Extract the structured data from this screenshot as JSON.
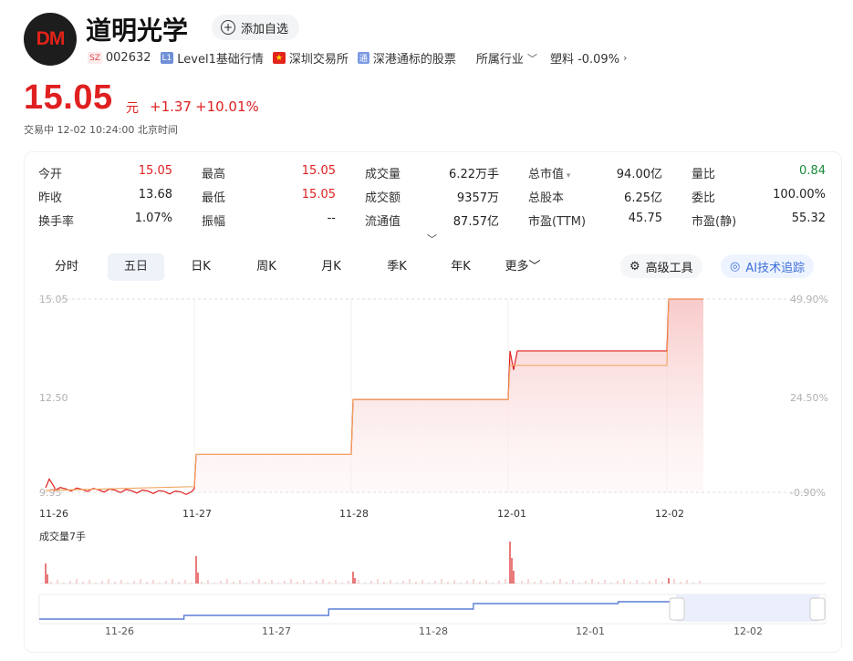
{
  "header": {
    "logo_text": "DM",
    "name": "道明光学",
    "add_label": "添加自选",
    "market_tag": "SZ",
    "code": "002632",
    "level_tag": "L1",
    "level": "Level1基础行情",
    "exchange": "深圳交易所",
    "connect_tag": "通",
    "connect": "深港通标的股票",
    "industry_label": "所属行业",
    "industry": "塑料 -0.09%"
  },
  "price": {
    "last": "15.05",
    "unit": "元",
    "change": "+1.37",
    "change_pct": "+10.01%",
    "status": "交易中  12-02 10:24:00  北京时间"
  },
  "quotes": [
    [
      {
        "label": "今开",
        "value": "15.05",
        "color": "red"
      },
      {
        "label": "最高",
        "value": "15.05",
        "color": "red"
      },
      {
        "label": "成交量",
        "value": "6.22万手"
      },
      {
        "label": "总市值",
        "value": "94.00亿"
      },
      {
        "label": "量比",
        "value": "0.84",
        "color": "green"
      }
    ],
    [
      {
        "label": "昨收",
        "value": "13.68"
      },
      {
        "label": "最低",
        "value": "15.05",
        "color": "red"
      },
      {
        "label": "成交额",
        "value": "9357万"
      },
      {
        "label": "总股本",
        "value": "6.25亿"
      },
      {
        "label": "委比",
        "value": "100.00%"
      }
    ],
    [
      {
        "label": "换手率",
        "value": "1.07%"
      },
      {
        "label": "振幅",
        "value": "--"
      },
      {
        "label": "流通值",
        "value": "87.57亿"
      },
      {
        "label": "市盈(TTM)",
        "value": "45.75"
      },
      {
        "label": "市盈(静)",
        "value": "55.32"
      }
    ]
  ],
  "tabs": [
    "分时",
    "五日",
    "日K",
    "周K",
    "月K",
    "季K",
    "年K",
    "更多"
  ],
  "active_tab": "五日",
  "tools": {
    "advanced": "高级工具",
    "ai": "AI技术追踪"
  },
  "colors": {
    "up": "#e02020",
    "down": "#1a8a3c",
    "avg_line": "#f0a35a",
    "nav_line": "#5b7fd6"
  },
  "chart_data": {
    "type": "line",
    "title": "",
    "x": [
      "11-26",
      "11-27",
      "11-28",
      "12-01",
      "12-02"
    ],
    "y_left_ticks": [
      "15.05",
      "12.50",
      "9.95"
    ],
    "y_right_ticks": [
      "49.90%",
      "24.50%",
      "-0.90%"
    ],
    "ylim": [
      9.95,
      15.05
    ],
    "series": [
      {
        "values": [
          10.05,
          10.95,
          12.4,
          13.68,
          15.05
        ]
      },
      {
        "values": [
          10.0,
          10.95,
          12.4,
          13.3,
          15.05
        ]
      }
    ],
    "volume_label": "成交量7手",
    "nav_x": [
      "11-26",
      "11-27",
      "11-28",
      "12-01",
      "12-02"
    ]
  }
}
